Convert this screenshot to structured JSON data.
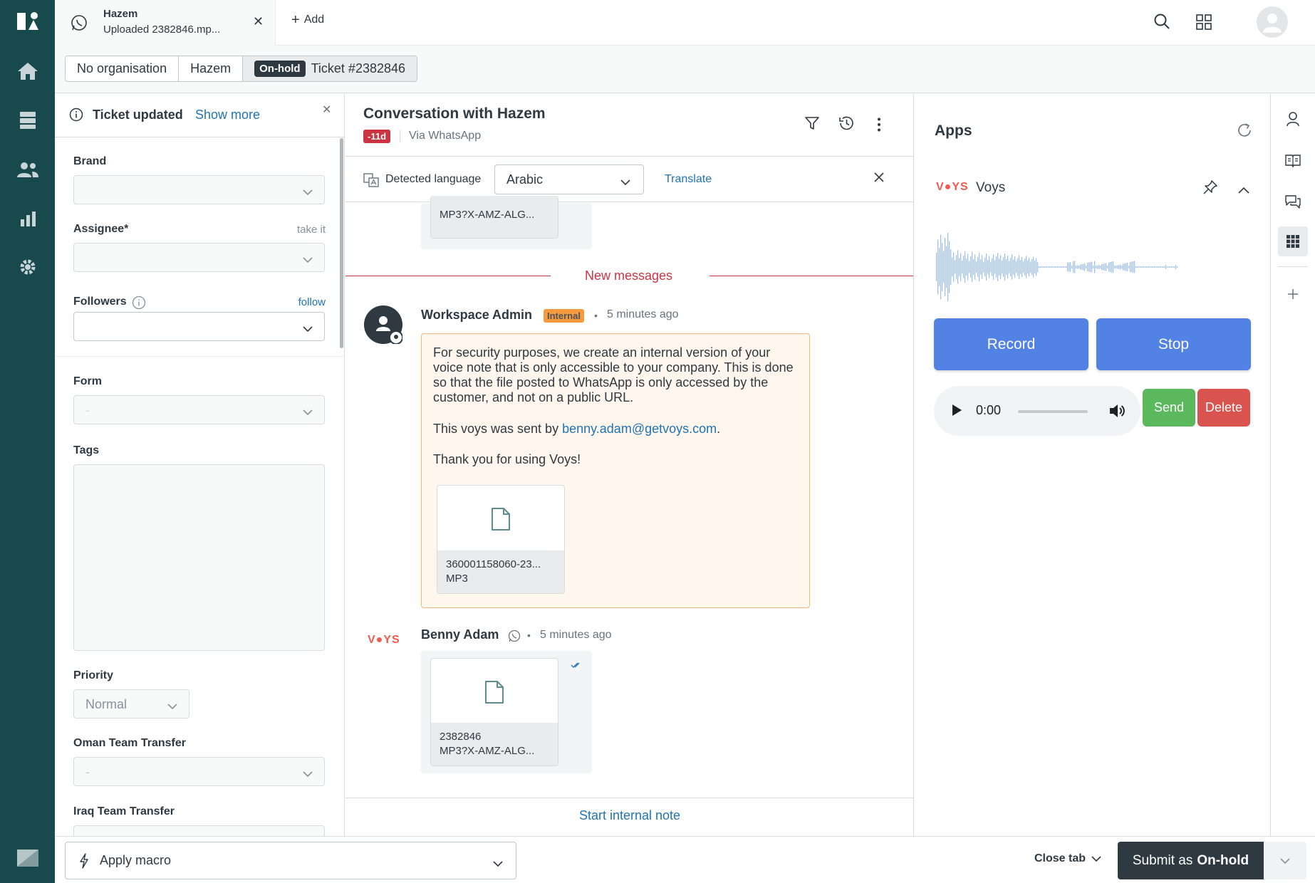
{
  "colors": {
    "nav_bg": "#17494d",
    "link": "#1f73b7",
    "danger": "#cc3340",
    "internal_badge": "#f79a3e",
    "internal_bubble": "#fff6ed",
    "voys_button": "#5282e4",
    "send_button": "#5cb85c",
    "delete_button": "#d9534f",
    "submit_button": "#2f3941"
  },
  "nav": {
    "items": [
      "logo-icon",
      "home-icon",
      "views-icon",
      "customers-icon",
      "reporting-icon",
      "admin-icon"
    ],
    "bottom": "zendesk-icon"
  },
  "tabs": {
    "active_title": "Hazem",
    "active_subtitle": "Uploaded 2382846.mp...",
    "add_label": "Add"
  },
  "breadcrumb": {
    "organisation": "No organisation",
    "requester": "Hazem",
    "status_badge": "On-hold",
    "ticket": "Ticket #2382846"
  },
  "properties": {
    "notice_title": "Ticket updated",
    "notice_link": "Show more",
    "brand_label": "Brand",
    "assignee_label": "Assignee*",
    "assignee_aside": "take it",
    "followers_label": "Followers",
    "followers_aside": "follow",
    "form_label": "Form",
    "form_value": "-",
    "tags_label": "Tags",
    "priority_label": "Priority",
    "priority_value": "Normal",
    "oman_label": "Oman Team Transfer",
    "oman_value": "-",
    "iraq_label": "Iraq Team Transfer"
  },
  "conversation": {
    "title": "Conversation with Hazem",
    "overdue": "-11d",
    "via": "Via WhatsApp",
    "detected_language_label": "Detected language",
    "language": "Arabic",
    "translate": "Translate",
    "top_attachment_name": "MP3?X-AMZ-ALG...",
    "new_messages": "New messages",
    "msg1": {
      "author": "Workspace Admin",
      "badge": "Internal",
      "time": "5 minutes ago",
      "para1": "For security purposes, we create an internal version of your voice note that is only accessible to your company. This is done so that the file posted to WhatsApp is only accessed by the customer, and not on a public URL.",
      "para2_prefix": "This voys was sent by ",
      "para2_email": "benny.adam@getvoys.com",
      "para2_suffix": ".",
      "para3": "Thank you for using Voys!",
      "attachment_line1": "360001158060-23...",
      "attachment_line2": "MP3"
    },
    "msg2": {
      "logo_text": "V●YS",
      "author": "Benny Adam",
      "time": "5 minutes ago",
      "attachment_line1": "2382846",
      "attachment_line2": "MP3?X-AMZ-ALG..."
    },
    "dot": "•",
    "internal_note": "Start internal note"
  },
  "apps": {
    "title": "Apps",
    "app_logo": "V●YS",
    "app_name": "Voys",
    "record": "Record",
    "stop": "Stop",
    "player_time": "0:00",
    "send": "Send",
    "delete": "Delete"
  },
  "rail": [
    "user-icon",
    "knowledge-icon",
    "conversations-icon",
    "apps-grid-icon",
    "add-icon"
  ],
  "footer": {
    "macro": "Apply macro",
    "close_tab": "Close tab",
    "submit_prefix": "Submit as",
    "submit_status": "On-hold"
  }
}
